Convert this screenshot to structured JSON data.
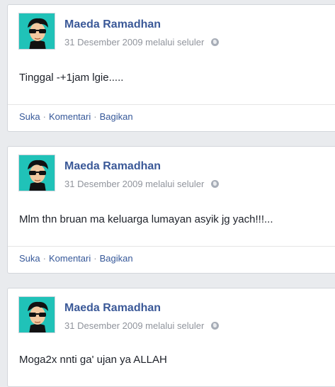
{
  "posts": [
    {
      "author": "Maeda Ramadhan",
      "meta": "31 Desember 2009 melalui seluler",
      "text": "Tinggal -+1jam lgie.....",
      "actions": {
        "like": "Suka",
        "comment": "Komentari",
        "share": "Bagikan",
        "separator": "·"
      }
    },
    {
      "author": "Maeda Ramadhan",
      "meta": "31 Desember 2009 melalui seluler",
      "text": "Mlm thn bruan ma keluarga lumayan asyik jg yach!!!...",
      "actions": {
        "like": "Suka",
        "comment": "Komentari",
        "share": "Bagikan",
        "separator": "·"
      }
    },
    {
      "author": "Maeda Ramadhan",
      "meta": "31 Desember 2009 melalui seluler",
      "text": "Moga2x nnti ga' ujan ya ALLAH"
    }
  ],
  "colors": {
    "author": "#3b5998",
    "link": "#365899",
    "meta": "#90949c",
    "avatar_bg": "#20c2b8",
    "background": "#e9ebee"
  },
  "icons": [
    "avatar-image",
    "globe-icon"
  ]
}
